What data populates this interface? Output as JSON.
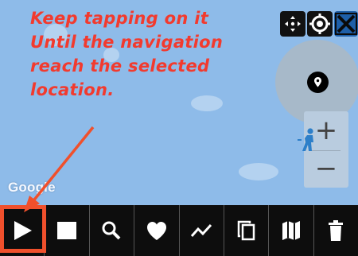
{
  "annotation": {
    "lines": [
      "Keep tapping on it",
      "Until the navigation",
      "reach the selected",
      "location."
    ],
    "color": "#f23a2e"
  },
  "map": {
    "attribution": "Google",
    "zoom_in_label": "+",
    "zoom_out_label": "−"
  },
  "top_controls": [
    "move-icon",
    "target-icon",
    "close-icon"
  ],
  "toolbar": {
    "buttons": [
      "play-icon",
      "stop-icon",
      "search-icon",
      "heart-icon",
      "trend-icon",
      "copy-icon",
      "map-icon",
      "trash-icon"
    ],
    "highlight_color": "#f0502c"
  }
}
